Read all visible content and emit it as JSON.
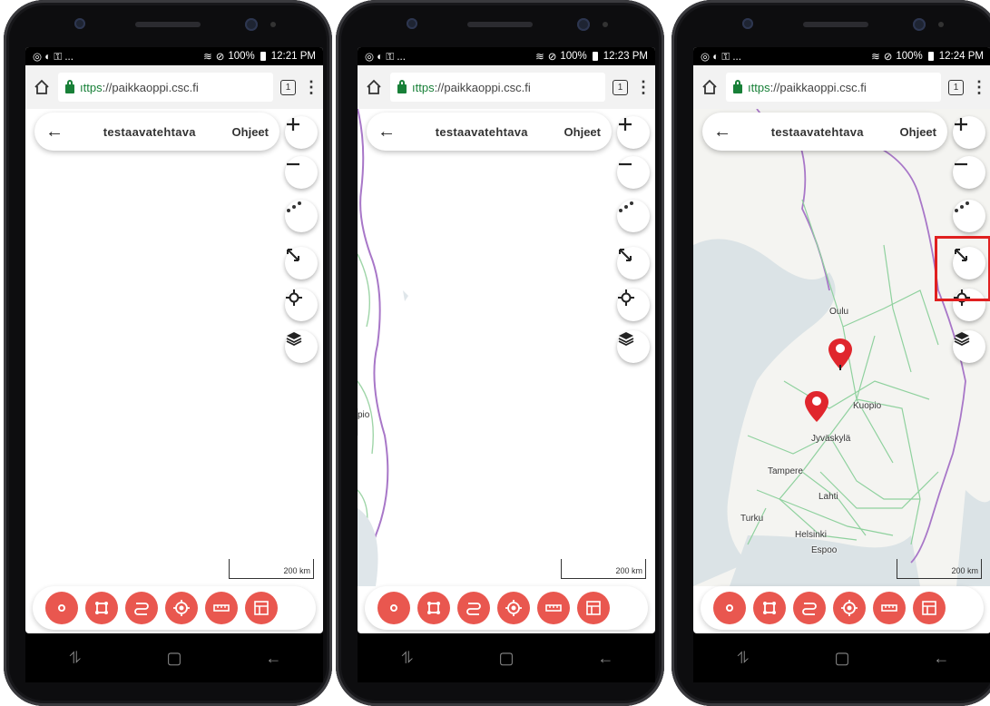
{
  "phones": [
    {
      "status": {
        "left": "◎ ◐ ⚿ ...",
        "battery": "100%",
        "time": "12:21 PM"
      },
      "browser": {
        "url_scheme": "ıttps",
        "url_rest": "://paikkaoppi.csc.fi",
        "tab_count": "1",
        "menu": "⋮"
      },
      "app": {
        "back": "←",
        "title": "testaavatehtava",
        "help": "Ohjeet"
      },
      "map": {
        "scale": "200 km"
      }
    },
    {
      "status": {
        "left": "◎ ◐ ⚿ ...",
        "battery": "100%",
        "time": "12:23 PM"
      },
      "browser": {
        "url_scheme": "ıttps",
        "url_rest": "://paikkaoppi.csc.fi",
        "tab_count": "1",
        "menu": "⋮"
      },
      "app": {
        "back": "←",
        "title": "testaavatehtava",
        "help": "Ohjeet"
      },
      "map": {
        "scale": "200 km",
        "edge_label": "pio"
      }
    },
    {
      "status": {
        "left": "◎ ◐ ⚿ ...",
        "battery": "100%",
        "time": "12:24 PM"
      },
      "browser": {
        "url_scheme": "ıttps",
        "url_rest": "://paikkaoppi.csc.fi",
        "tab_count": "1",
        "menu": "⋮"
      },
      "app": {
        "back": "←",
        "title": "testaavatehtava",
        "help": "Ohjeet"
      },
      "map": {
        "scale": "200 km",
        "cities": {
          "oulu": "Oulu",
          "kuopio": "Kuopio",
          "jyvaskyla": "Jyväskylä",
          "tampere": "Tampere",
          "lahti": "Lahti",
          "turku": "Turku",
          "helsinki": "Helsinki",
          "espoo": "Espoo"
        }
      }
    }
  ],
  "map_controls": [
    "zoom-in",
    "zoom-out",
    "points",
    "fullscreen",
    "locate",
    "layers"
  ],
  "toolbar_tools": [
    "point",
    "polygon",
    "line",
    "target",
    "measure",
    "layout"
  ],
  "colors": {
    "tool_red": "#e9574f",
    "highlight": "#e02020",
    "pin": "#e0262d",
    "border_purple": "#9b59b6",
    "roads": "#8fd19e"
  }
}
